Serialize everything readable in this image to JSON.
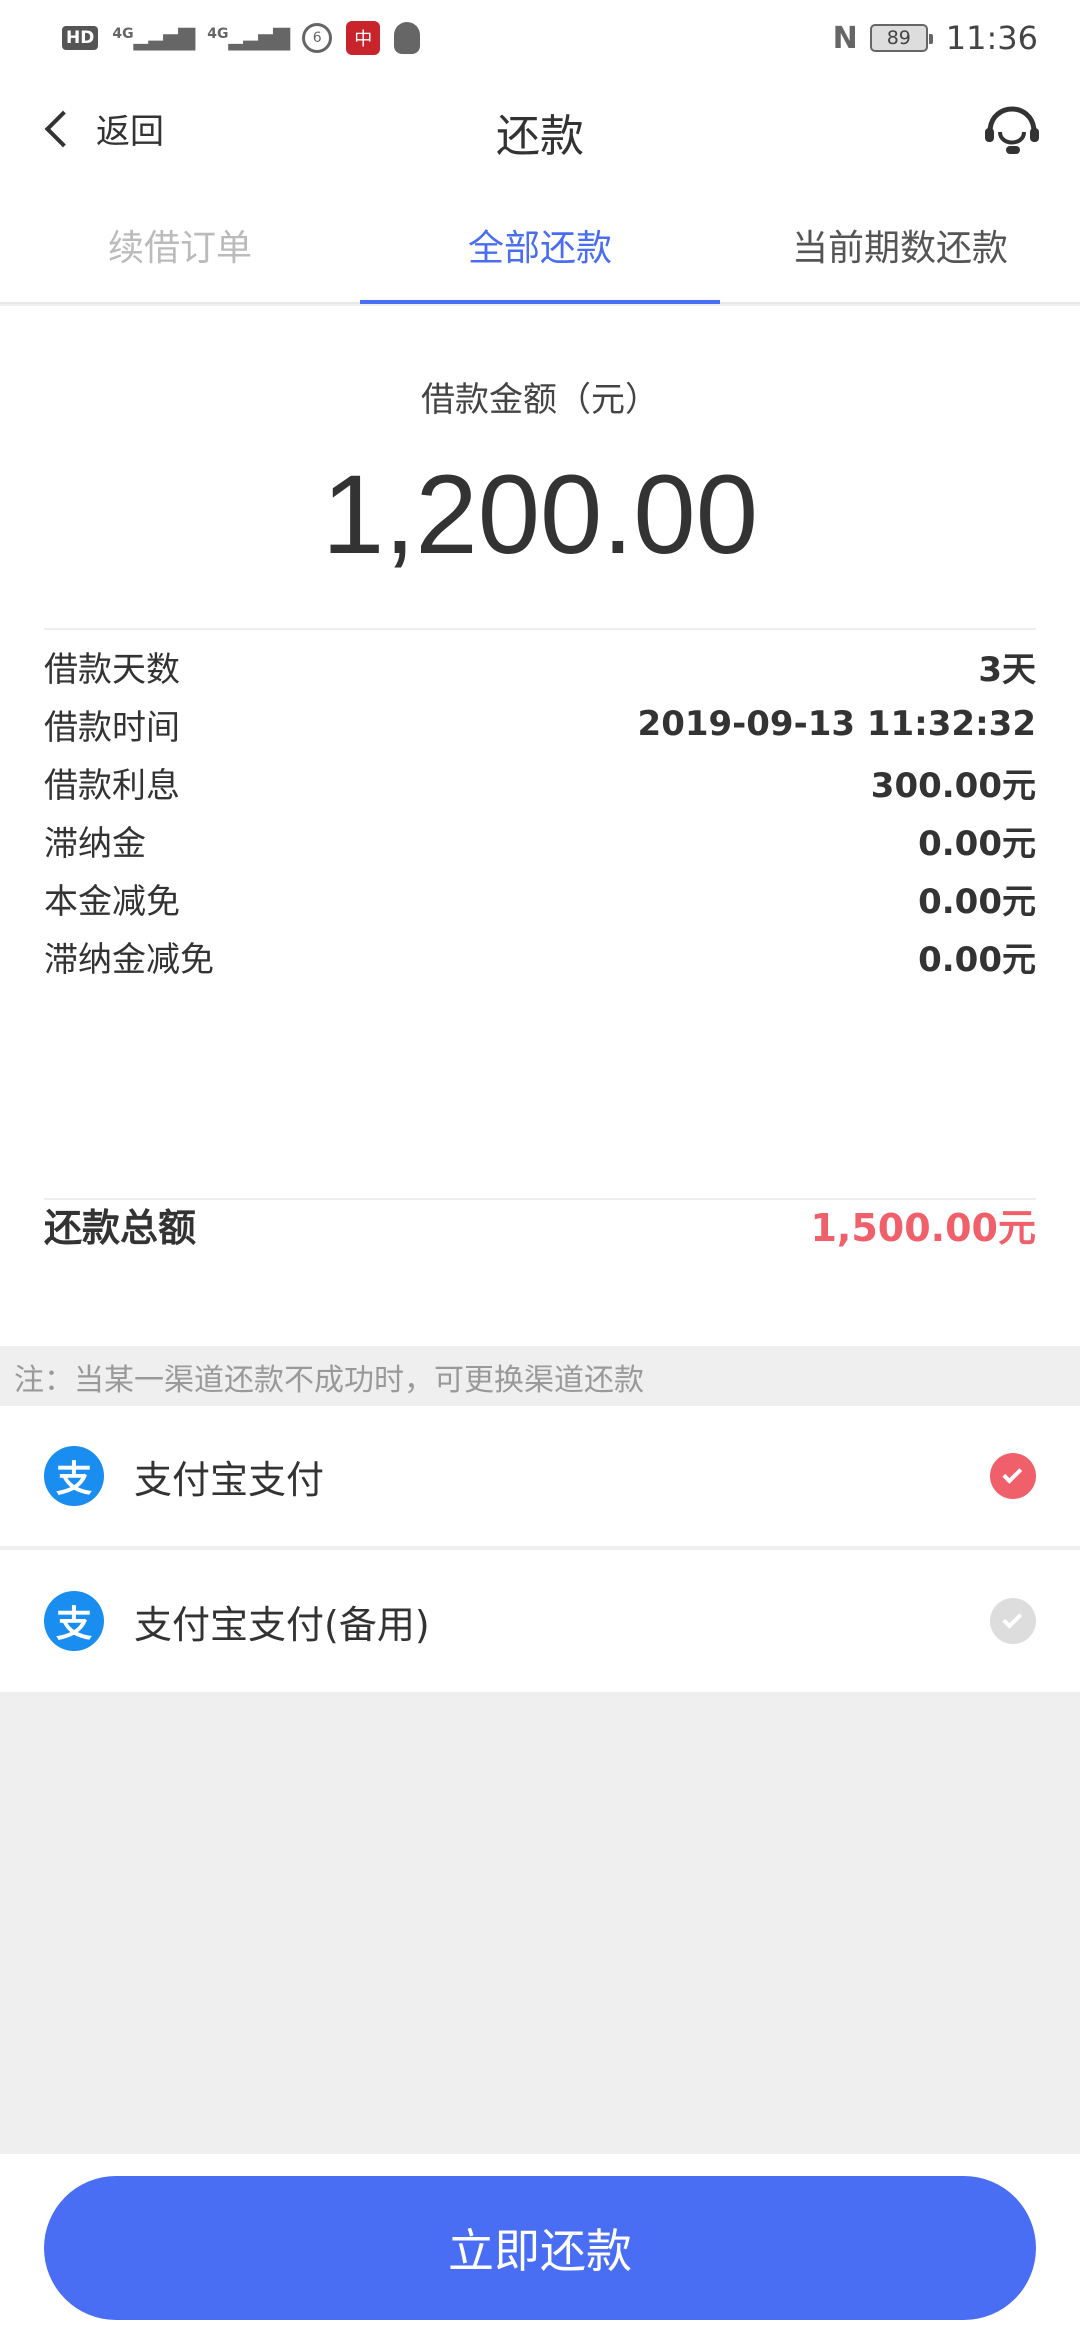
{
  "status_bar": {
    "hd": "HD",
    "signal1": "4G",
    "signal2": "4G",
    "battery": "89",
    "time": "11:36"
  },
  "nav": {
    "back_label": "返回",
    "title": "还款"
  },
  "tabs": [
    {
      "label": "续借订单"
    },
    {
      "label": "全部还款"
    },
    {
      "label": "当前期数还款"
    }
  ],
  "loan": {
    "amount_label": "借款金额（元）",
    "amount": "1,200.00",
    "details": [
      {
        "key": "借款天数",
        "value": "3天"
      },
      {
        "key": "借款时间",
        "value": "2019-09-13 11:32:32"
      },
      {
        "key": "借款利息",
        "value": "300.00元"
      },
      {
        "key": "滞纳金",
        "value": "0.00元"
      },
      {
        "key": "本金减免",
        "value": "0.00元"
      },
      {
        "key": "滞纳金减免",
        "value": "0.00元"
      }
    ],
    "total_label": "还款总额",
    "total_value": "1,500.00元"
  },
  "note": "注：当某一渠道还款不成功时，可更换渠道还款",
  "payment_methods": [
    {
      "icon": "支",
      "name": "支付宝支付",
      "selected": true
    },
    {
      "icon": "支",
      "name": "支付宝支付(备用)",
      "selected": false
    }
  ],
  "colors": {
    "accent": "#4a6ef3",
    "total": "#f0606a",
    "alipay": "#1a8df0"
  },
  "footer": {
    "pay_button": "立即还款"
  }
}
